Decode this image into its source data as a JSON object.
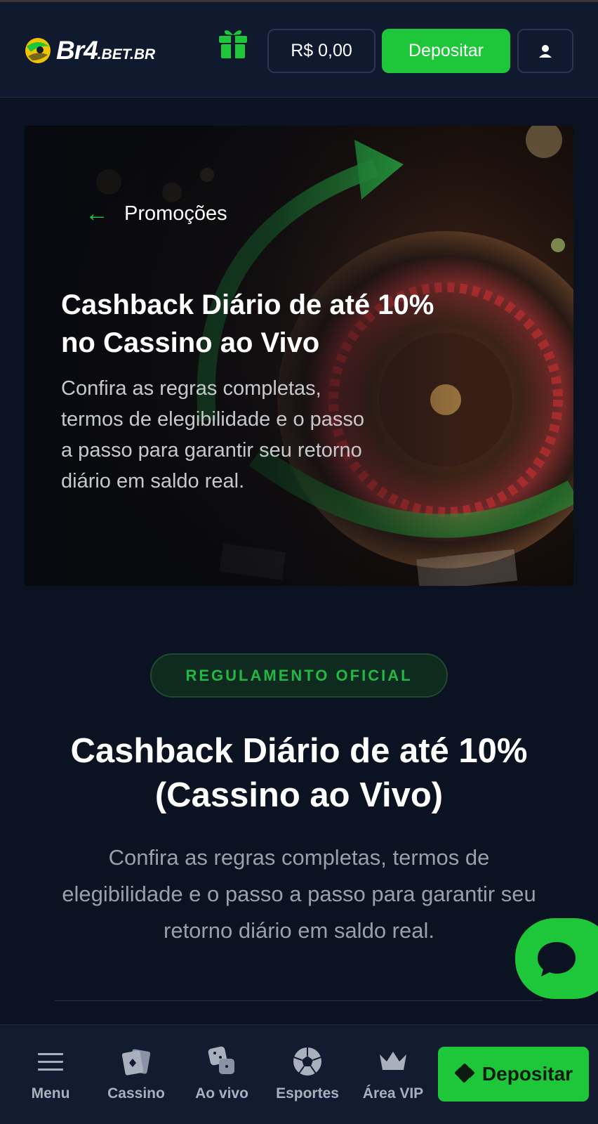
{
  "header": {
    "logo_main": "Br4",
    "logo_suffix": ".BET.BR",
    "gift_icon": "gift-icon",
    "balance": "R$ 0,00",
    "deposit_label": "Depositar",
    "user_icon": "user-icon"
  },
  "hero": {
    "back_label": "Promoções",
    "title": "Cashback Diário de até 10% no Cassino ao Vivo",
    "description": "Confira as regras completas, termos de elegibilidade e o passo a passo para garantir seu retorno diário em saldo real."
  },
  "content": {
    "badge": "REGULAMENTO OFICIAL",
    "title": "Cashback Diário de até 10% (Cassino ao Vivo)",
    "description": "Confira as regras completas, termos de elegibilidade e o passo a passo para garantir seu retorno diário em saldo real."
  },
  "bottom_nav": {
    "items": [
      {
        "label": "Menu",
        "icon": "menu-icon"
      },
      {
        "label": "Cassino",
        "icon": "cards-icon"
      },
      {
        "label": "Ao vivo",
        "icon": "dice-icon"
      },
      {
        "label": "Esportes",
        "icon": "soccer-ball-icon"
      },
      {
        "label": "Área VIP",
        "icon": "crown-icon"
      }
    ],
    "deposit_label": "Depositar"
  },
  "colors": {
    "accent": "#1ec63a",
    "background": "#0b1221",
    "header": "#0f1a2e"
  }
}
